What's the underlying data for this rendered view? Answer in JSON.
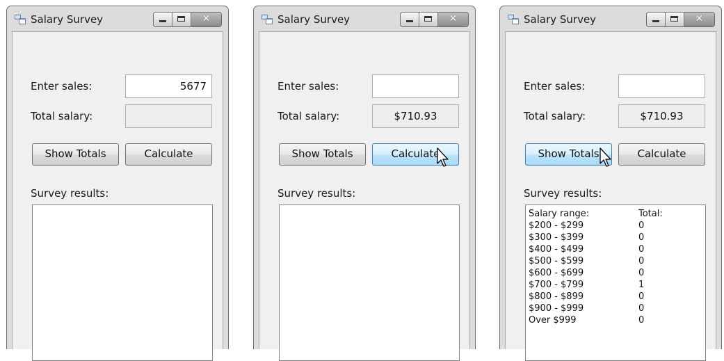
{
  "windows": [
    {
      "title": "Salary Survey",
      "labels": {
        "sales": "Enter sales:",
        "total": "Total salary:",
        "survey": "Survey results:"
      },
      "sales_value": "5677",
      "total_value": "",
      "buttons": {
        "show": "Show Totals",
        "calculate": "Calculate"
      },
      "results": []
    },
    {
      "title": "Salary Survey",
      "labels": {
        "sales": "Enter sales:",
        "total": "Total salary:",
        "survey": "Survey results:"
      },
      "sales_value": "",
      "total_value": "$710.93",
      "buttons": {
        "show": "Show Totals",
        "calculate": "Calculate"
      },
      "results": []
    },
    {
      "title": "Salary Survey",
      "labels": {
        "sales": "Enter sales:",
        "total": "Total salary:",
        "survey": "Survey results:"
      },
      "sales_value": "",
      "total_value": "$710.93",
      "buttons": {
        "show": "Show Totals",
        "calculate": "Calculate"
      },
      "results": [
        {
          "range": "Salary range:",
          "total": "Total:"
        },
        {
          "range": "$200 - $299",
          "total": "0"
        },
        {
          "range": "$300 - $399",
          "total": "0"
        },
        {
          "range": "$400 - $499",
          "total": "0"
        },
        {
          "range": "$500 - $599",
          "total": "0"
        },
        {
          "range": "$600 - $699",
          "total": "0"
        },
        {
          "range": "$700 - $799",
          "total": "1"
        },
        {
          "range": "$800 - $899",
          "total": "0"
        },
        {
          "range": "$900 - $999",
          "total": "0"
        },
        {
          "range": "Over $999",
          "total": "0"
        }
      ]
    }
  ],
  "icons": {
    "app": "application-icon",
    "minimize": "minimize-icon",
    "maximize": "maximize-icon",
    "close": "close-icon",
    "cursor": "mouse-pointer-icon"
  }
}
